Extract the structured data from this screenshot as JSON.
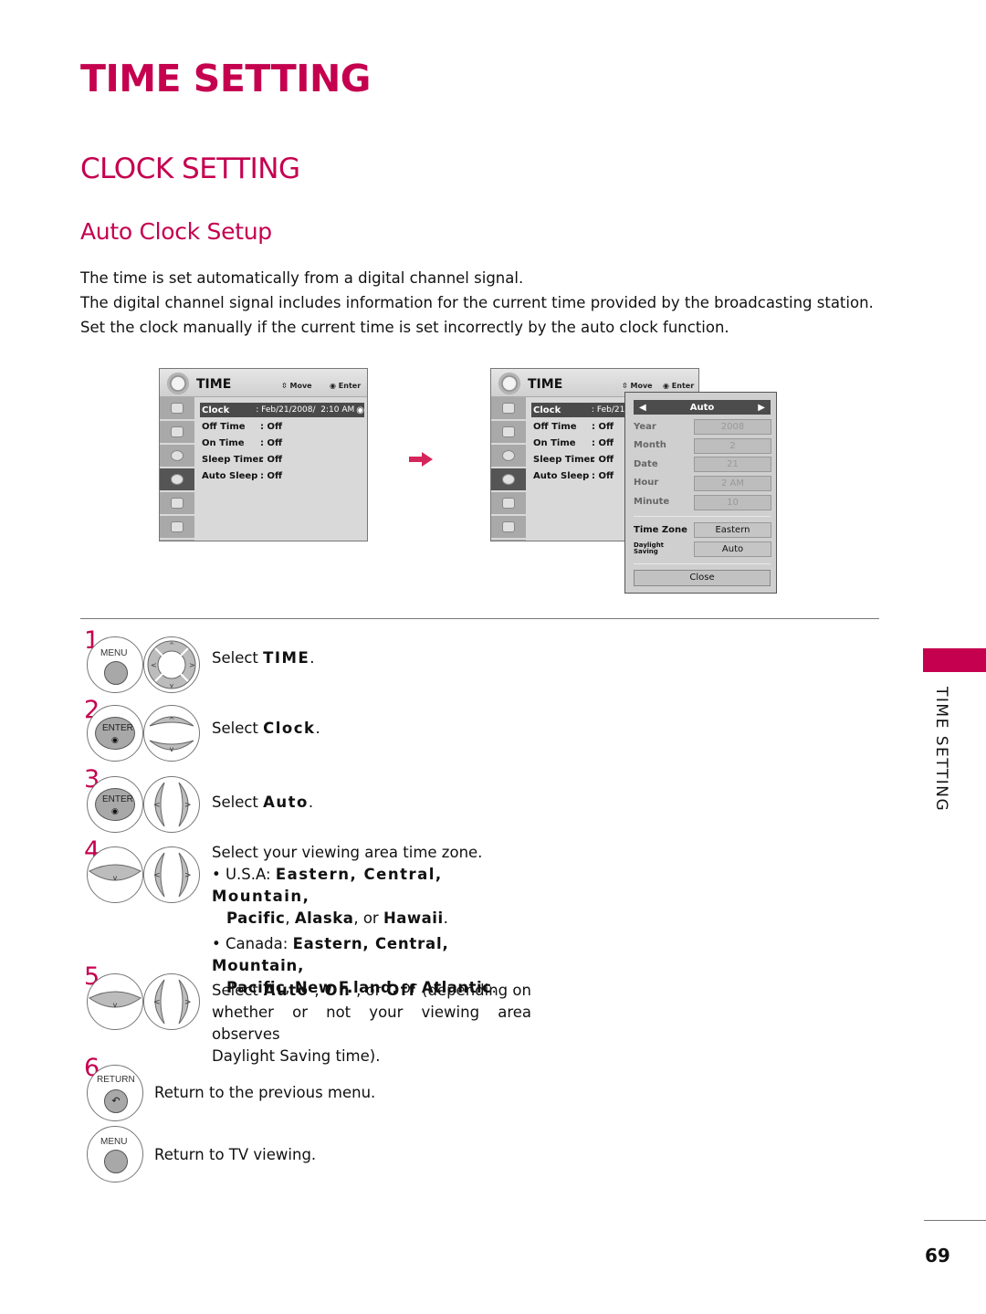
{
  "page": {
    "title": "TIME SETTING",
    "section": "CLOCK SETTING",
    "subsection": "Auto Clock Setup",
    "intro": [
      "The time is set automatically from a digital channel signal.",
      "The digital channel signal includes information for the current time provided by the broadcasting station.",
      "Set the clock manually if the current time is set incorrectly by the auto clock function."
    ],
    "side_tab": "TIME SETTING",
    "page_number": "69",
    "accent_color": "#c5004f"
  },
  "menu1": {
    "title": "TIME",
    "move": "Move",
    "enter": "Enter",
    "rows": [
      {
        "label": "Clock",
        "value": ": Feb/21/2008/  2:10 AM"
      },
      {
        "label": "Off Time",
        "value": ": Off"
      },
      {
        "label": "On Time",
        "value": ": Off"
      },
      {
        "label": "Sleep Timer",
        "value": ": Off"
      },
      {
        "label": "Auto Sleep",
        "value": ": Off"
      }
    ]
  },
  "menu2": {
    "title": "TIME",
    "move": "Move",
    "enter": "Enter",
    "rows": [
      {
        "label": "Clock",
        "value": ": Feb/21/"
      },
      {
        "label": "Off Time",
        "value": ": Off"
      },
      {
        "label": "On Time",
        "value": ": Off"
      },
      {
        "label": "Sleep Timer",
        "value": ": Off"
      },
      {
        "label": "Auto Sleep",
        "value": ": Off"
      }
    ],
    "popup": {
      "mode": "Auto",
      "fields": [
        {
          "label": "Year",
          "value": "2008"
        },
        {
          "label": "Month",
          "value": "2"
        },
        {
          "label": "Date",
          "value": "21"
        },
        {
          "label": "Hour",
          "value": "2 AM"
        },
        {
          "label": "Minute",
          "value": "10"
        }
      ],
      "time_zone_label": "Time Zone",
      "time_zone_value": "Eastern",
      "daylight_label_1": "Daylight",
      "daylight_label_2": "Saving",
      "daylight_value": "Auto",
      "close": "Close"
    }
  },
  "buttons": {
    "menu": "MENU",
    "enter": "ENTER",
    "return": "RETURN"
  },
  "steps": [
    {
      "num": "1",
      "pre": "Select ",
      "bold": "TIME",
      "post": "."
    },
    {
      "num": "2",
      "pre": "Select ",
      "bold": "Clock",
      "post": "."
    },
    {
      "num": "3",
      "pre": "Select ",
      "bold": "Auto",
      "post": "."
    },
    {
      "num": "4",
      "text": "Select your viewing area time zone.",
      "usa_prefix": "• U.S.A: ",
      "usa_line1": "Eastern,  Central,  Mountain,",
      "usa_line2_bold1": "Pacific",
      "usa_line2_sep": ", ",
      "usa_line2_bold2": "Alaska",
      "usa_line2_or": ", or ",
      "usa_line2_bold3": "Hawaii",
      "canada_prefix": "• Canada: ",
      "canada_line1": "Eastern,  Central,  Mountain,",
      "canada_line2_bold1": "Pacific",
      "canada_line2_bold2": "New F.land",
      "canada_line2_bold3": "Atlantic"
    },
    {
      "num": "5",
      "line1_pre": "Select ",
      "auto": "Auto",
      "on": "On",
      "off": "Off",
      "line1_post": "(depending on",
      "line2": "whether or not your viewing area observes",
      "line3": "Daylight Saving time)."
    },
    {
      "num": "6",
      "text": "Return to the previous menu."
    },
    {
      "num": "",
      "text": "Return to TV viewing."
    }
  ]
}
